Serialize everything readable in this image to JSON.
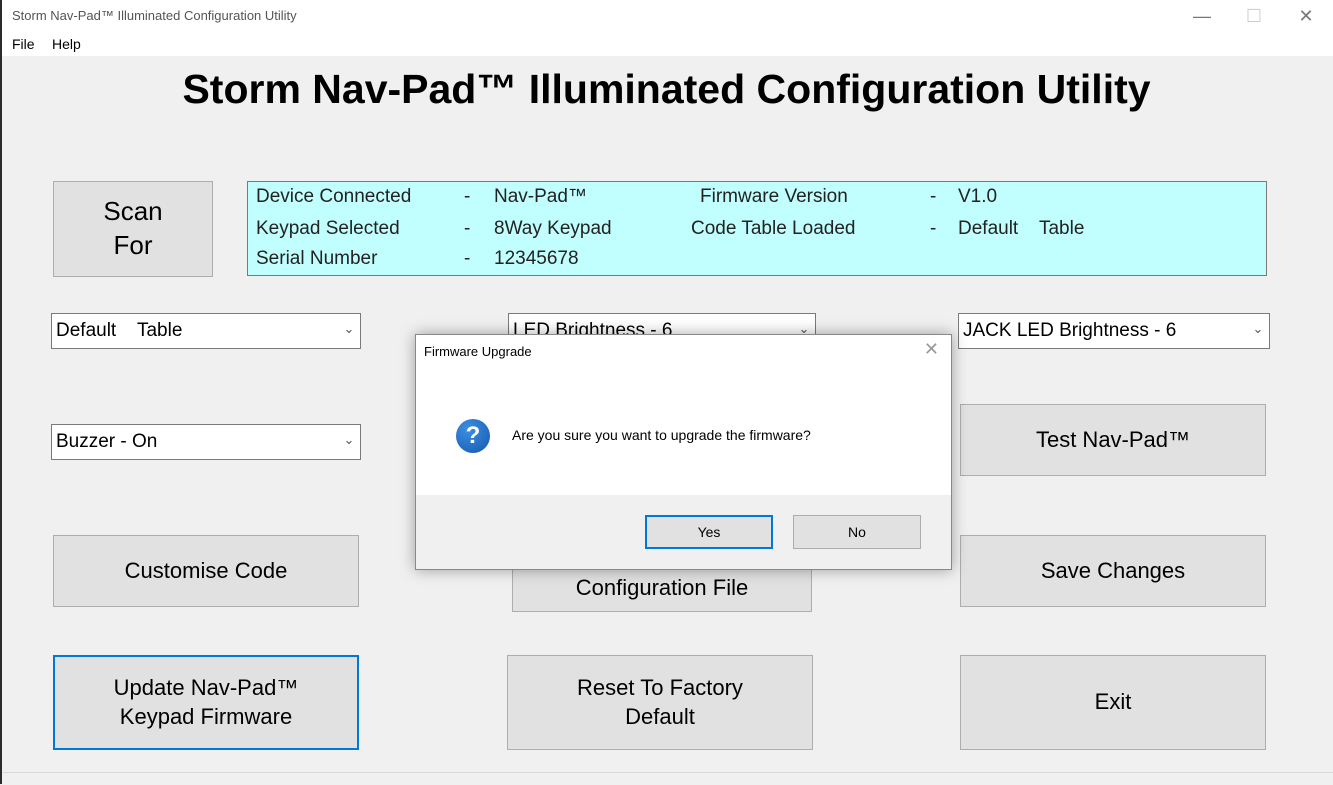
{
  "window": {
    "title": "Storm Nav-Pad™ Illuminated Configuration Utility",
    "minimize_glyph": "—",
    "maximize_glyph": "☐",
    "close_glyph": "✕"
  },
  "menu": [
    "File",
    "Help"
  ],
  "heading": "Storm Nav-Pad™ Illuminated Configuration Utility",
  "scan_button": {
    "line1": "Scan",
    "line2": "For"
  },
  "info": {
    "device_connected_label": "Device Connected",
    "device_connected_value": "Nav-Pad™",
    "keypad_selected_label": "Keypad Selected",
    "keypad_selected_value": "8Way Keypad",
    "serial_number_label": "Serial Number",
    "serial_number_value": "12345678",
    "firmware_version_label": "Firmware Version",
    "firmware_version_value": "V1.0",
    "code_table_label": "Code Table Loaded",
    "code_table_value": "Default    Table",
    "separator": "-"
  },
  "combos": {
    "table": "Default    Table",
    "led_brightness": "LED Brightness - 6",
    "jack_led_brightness": "JACK LED Brightness - 6",
    "buzzer": "Buzzer - On"
  },
  "buttons": {
    "test": "Test Nav-Pad™",
    "customise": "Customise Code",
    "configuration_file": "Configuration File",
    "save": "Save Changes",
    "update_line1": "Update Nav-Pad™",
    "update_line2": "Keypad Firmware",
    "reset_line1": "Reset To Factory",
    "reset_line2": "Default",
    "exit": "Exit"
  },
  "dialog": {
    "title": "Firmware Upgrade",
    "close_glyph": "✕",
    "icon_glyph": "?",
    "message": "Are you sure you want to upgrade the firmware?",
    "yes": "Yes",
    "no": "No"
  },
  "colors": {
    "info_panel": "#c1ffff",
    "focus_border": "#0078d7",
    "question_icon": "#1e6fc8"
  }
}
